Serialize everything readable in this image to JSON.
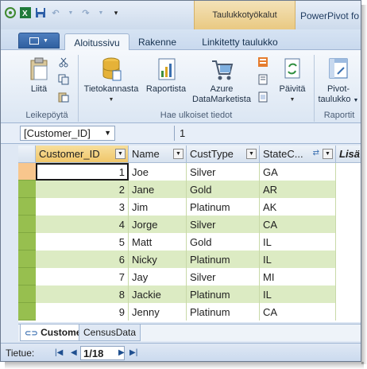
{
  "window": {
    "contextual_tab_group": "Taulukkotyökalut",
    "app_title": "PowerPivot fo"
  },
  "tabs": [
    {
      "label": "Aloitussivu",
      "active": true
    },
    {
      "label": "Rakenne",
      "active": false
    },
    {
      "label": "Linkitetty taulukko",
      "active": false
    }
  ],
  "ribbon": {
    "groups": {
      "clipboard": "Leikepöytä",
      "external_data": "Hae ulkoiset tiedot",
      "reports": "Raportit"
    },
    "buttons": {
      "paste": "Liitä",
      "database": "Tietokannasta",
      "report": "Raportista",
      "azure_line1": "Azure",
      "azure_line2": "DataMarketista",
      "refresh": "Päivitä",
      "pivot_line1": "Pivot-",
      "pivot_line2": "taulukko"
    }
  },
  "formula_bar": {
    "name_box": "[Customer_ID]",
    "value": "1"
  },
  "grid": {
    "columns": [
      "Customer_ID",
      "Name",
      "CustType",
      "StateC...",
      "Lisä"
    ],
    "rows": [
      {
        "id": "1",
        "name": "Joe",
        "type": "Silver",
        "state": "GA"
      },
      {
        "id": "2",
        "name": "Jane",
        "type": "Gold",
        "state": "AR"
      },
      {
        "id": "3",
        "name": "Jim",
        "type": "Platinum",
        "state": "AK"
      },
      {
        "id": "4",
        "name": "Jorge",
        "type": "Silver",
        "state": "CA"
      },
      {
        "id": "5",
        "name": "Matt",
        "type": "Gold",
        "state": "IL"
      },
      {
        "id": "6",
        "name": "Nicky",
        "type": "Platinum",
        "state": "IL"
      },
      {
        "id": "7",
        "name": "Jay",
        "type": "Silver",
        "state": "MI"
      },
      {
        "id": "8",
        "name": "Jackie",
        "type": "Platinum",
        "state": "IL"
      },
      {
        "id": "9",
        "name": "Jenny",
        "type": "Platinum",
        "state": "CA"
      }
    ]
  },
  "sheet_tabs": [
    {
      "label": "Customer",
      "active": true
    },
    {
      "label": "CensusData",
      "active": false
    }
  ],
  "status": {
    "label": "Tietue:",
    "record": "1/18"
  },
  "colors": {
    "row_selector": "#97bf4f",
    "alt_row": "#dcebc3",
    "contextual": "#e9c982"
  }
}
